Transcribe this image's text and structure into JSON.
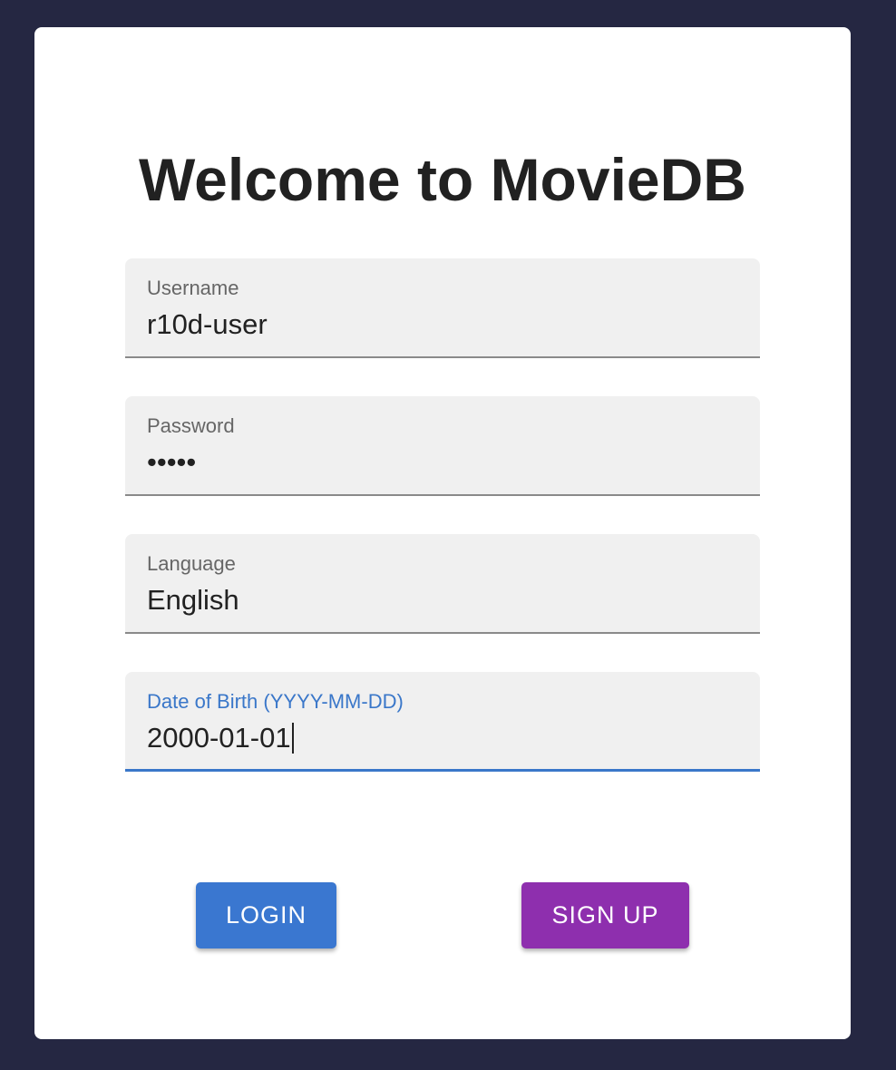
{
  "title": "Welcome to MovieDB",
  "fields": {
    "username": {
      "label": "Username",
      "value": "r10d-user"
    },
    "password": {
      "label": "Password",
      "value": "•••••"
    },
    "language": {
      "label": "Language",
      "value": "English"
    },
    "dob": {
      "label": "Date of Birth (YYYY-MM-DD)",
      "value": "2000-01-01"
    }
  },
  "buttons": {
    "login": "LOGIN",
    "signup": "SIGN UP"
  },
  "colors": {
    "background": "#252742",
    "accent_blue": "#3a77d0",
    "accent_purple": "#8e2fae"
  }
}
